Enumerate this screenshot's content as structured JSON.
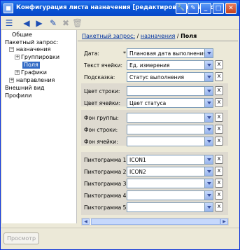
{
  "window": {
    "title": "Конфигурация листа назначения [редактирование записи]",
    "controls": [
      "🔧",
      "✎",
      "_",
      "□",
      "✕"
    ]
  },
  "toolbar": {
    "icons": [
      "☰",
      "◀",
      "▶",
      "✎",
      "✖",
      "🗑"
    ]
  },
  "tree": {
    "items": [
      {
        "label": "Общие",
        "indent": 0
      },
      {
        "label": "Пакетный запрос:",
        "indent": 0
      },
      {
        "label": "назначения",
        "indent": 1
      },
      {
        "label": "Группировки",
        "indent": 2
      },
      {
        "label": "Поля",
        "indent": 3,
        "selected": true
      },
      {
        "label": "Графики",
        "indent": 2
      },
      {
        "label": "направления",
        "indent": 1
      },
      {
        "label": "Внешний вид",
        "indent": 0
      },
      {
        "label": "Профили",
        "indent": 0
      }
    ]
  },
  "breadcrumb": {
    "link1": "Пакетный запрос:",
    "sep1": " / ",
    "link2": "назначения",
    "sep2": " / ",
    "current": "Поля"
  },
  "fields": [
    {
      "label": "Дата:",
      "required": "*",
      "value": "Плановая дата выполнения",
      "clear": false
    },
    {
      "label": "Текст ячейки:",
      "value": "Ед. измерения",
      "clear": true
    },
    {
      "label": "Подсказка:",
      "value": "Статус выполнения",
      "clear": true
    },
    {
      "label": "Цвет строки:",
      "value": "",
      "clear": true
    },
    {
      "label": "Цвет ячейки:",
      "value": "Цвет статуса",
      "clear": true
    },
    {
      "label": "Фон группы:",
      "value": "",
      "clear": true
    },
    {
      "label": "Фон строки:",
      "value": "",
      "clear": true
    },
    {
      "label": "Фон ячейки:",
      "value": "",
      "clear": true
    },
    {
      "label": "Пиктограмма 1:",
      "value": "ICON1",
      "clear": true
    },
    {
      "label": "Пиктограмма 2:",
      "value": "ICON2",
      "clear": true
    },
    {
      "label": "Пиктограмма 3:",
      "value": "",
      "clear": true
    },
    {
      "label": "Пиктограмма 4:",
      "value": "",
      "clear": true
    },
    {
      "label": "Пиктограмма 5:",
      "value": "",
      "clear": true
    }
  ],
  "clear_label": "X",
  "scroll": {
    "left": "◀",
    "right": "▶"
  },
  "preview_button": "Просмотр"
}
